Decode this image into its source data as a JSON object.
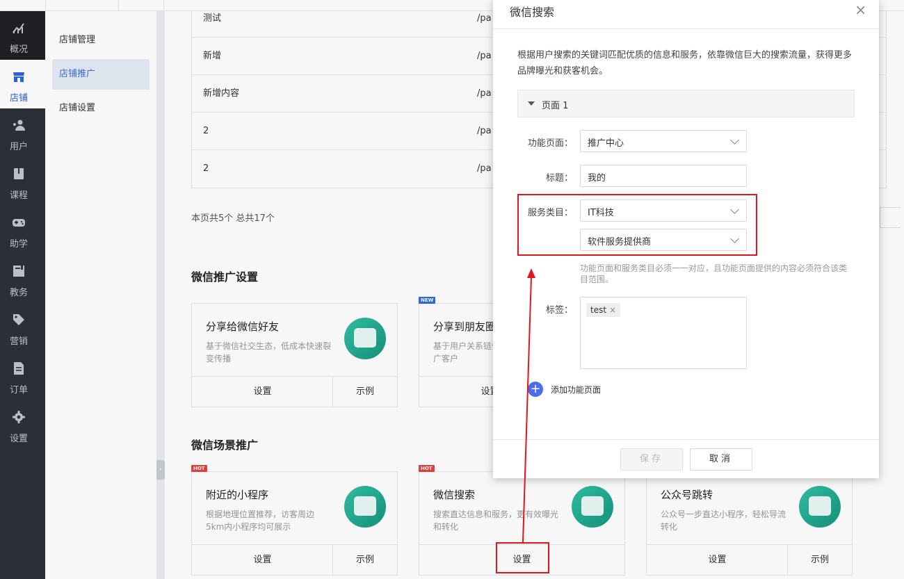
{
  "nav": {
    "items": [
      {
        "label": "概况",
        "icon": "chart-icon"
      },
      {
        "label": "店铺",
        "icon": "store-icon"
      },
      {
        "label": "用户",
        "icon": "users-icon"
      },
      {
        "label": "课程",
        "icon": "book-icon"
      },
      {
        "label": "助学",
        "icon": "gamepad-icon"
      },
      {
        "label": "教务",
        "icon": "calendar-icon"
      },
      {
        "label": "营销",
        "icon": "tag-icon"
      },
      {
        "label": "订单",
        "icon": "document-icon"
      },
      {
        "label": "设置",
        "icon": "gear-icon"
      }
    ]
  },
  "subnav": {
    "items": [
      {
        "label": "店铺管理"
      },
      {
        "label": "店铺推广"
      },
      {
        "label": "店铺设置"
      }
    ]
  },
  "table": {
    "rows": [
      {
        "name": "测试",
        "path": "/pa"
      },
      {
        "name": "新增",
        "path": "/pa"
      },
      {
        "name": "新增内容",
        "path": "/pa"
      },
      {
        "name": "2",
        "path": "/pa"
      },
      {
        "name": "2",
        "path": "/pa"
      }
    ],
    "pager_text": "本页共5个 总共17个"
  },
  "sections": {
    "wechat_promo": "微信推广设置",
    "wechat_scene": "微信场景推广"
  },
  "cards": {
    "share_friend": {
      "title": "分享给微信好友",
      "desc": "基于微信社交生态，低成本快速裂变传播",
      "set": "设置",
      "example": "示例"
    },
    "share_moments": {
      "title": "分享到朋友圈",
      "desc": "基于用户关系链传播，触达更多更广客户",
      "set": "设置",
      "badge": "NEW"
    },
    "nearby": {
      "title": "附近的小程序",
      "desc": "根据地理位置推荐，访客周边5km内小程序均可展示",
      "set": "设置",
      "example": "示例",
      "badge": "HOT"
    },
    "search": {
      "title": "微信搜索",
      "desc": "搜索直达信息和服务，更有效曝光和转化",
      "set": "设置",
      "badge": "HOT"
    },
    "official": {
      "title": "公众号跳转",
      "desc": "公众号一步直达小程序，轻松导流转化",
      "set": "设置",
      "example": "示例"
    }
  },
  "modal": {
    "title": "微信搜索",
    "close": "×",
    "desc": "根据用户搜索的关键词匹配优质的信息和服务，依靠微信巨大的搜索流量，获得更多品牌曝光和获客机会。",
    "page_panel": "页面 1",
    "func_page_label": "功能页面：",
    "func_page_value": "推广中心",
    "title_label": "标题：",
    "title_value": "我的",
    "service_label": "服务类目：",
    "service_value_1": "IT科技",
    "service_value_2": "软件服务提供商",
    "hint": "功能页面和服务类目必须一一对应，且功能页面提供的内容必须符合该类目范围。",
    "tags_label": "标签：",
    "tag_value": "test",
    "tag_remove": "×",
    "add_page": "添加功能页面",
    "add_plus": "+",
    "save": "保存",
    "cancel": "取消"
  },
  "colors": {
    "nav_bg": "#2e3138",
    "accent": "#2d62e0",
    "annotation": "#e0161c",
    "card_icon": "#1fa88d"
  }
}
